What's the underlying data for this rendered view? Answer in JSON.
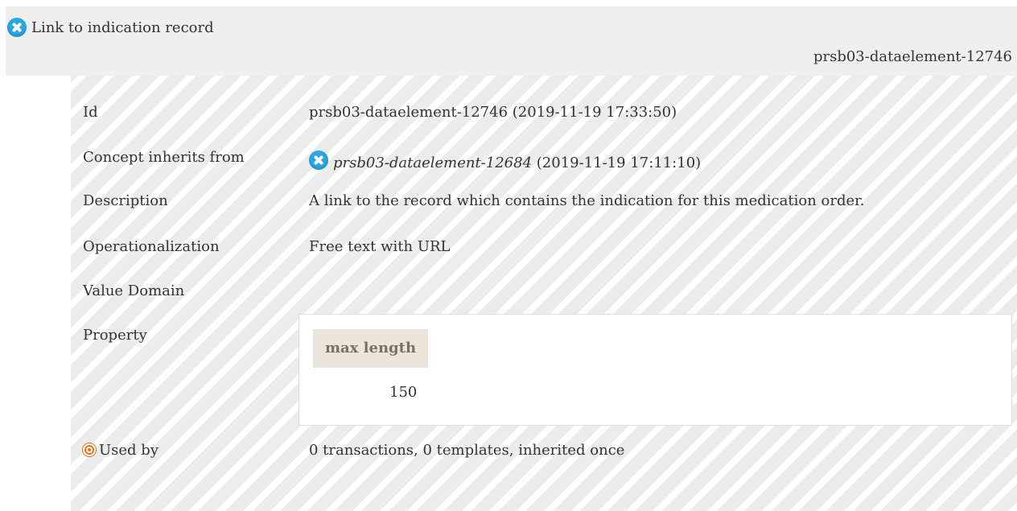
{
  "header": {
    "title": "Link to indication record",
    "id": "prsb03-dataelement-12746",
    "icon": "concept-icon"
  },
  "details": {
    "id_label": "Id",
    "id_value": "prsb03-dataelement-12746 (2019-11-19 17:33:50)",
    "inherits_label": "Concept inherits from",
    "inherits_ref": "prsb03-dataelement-12684",
    "inherits_date": "(2019-11-19 17:11:10)",
    "description_label": "Description",
    "description_value": "A link to the record which contains the indication for this medication order.",
    "operationalization_label": "Operationalization",
    "operationalization_value": "Free text with URL",
    "value_domain_label": "Value Domain",
    "property_label": "Property",
    "property": {
      "header": "max length",
      "value": "150"
    },
    "used_by_label": "Used by",
    "used_by_value": "0 transactions, 0 templates, inherited once"
  },
  "colors": {
    "header_bg": "#efefef",
    "icon_blue": "#2aa7e0",
    "property_header_bg": "#ebe5dc",
    "used_by_icon": "#ff6a00"
  }
}
